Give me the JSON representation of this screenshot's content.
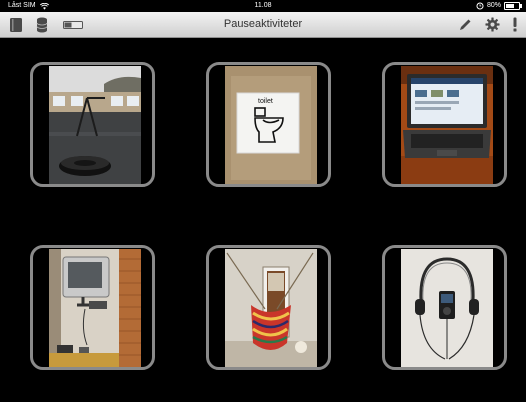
{
  "status_bar": {
    "carrier": "Låst SIM",
    "time": "11.08",
    "battery": "80%",
    "battery_level": 0.8,
    "icons": [
      "wifi-icon",
      "alarm-icon",
      "battery-icon"
    ]
  },
  "toolbar": {
    "title": "Pauseaktiviteter",
    "left_icons": [
      "book-icon",
      "database-icon",
      "toggle-icon"
    ],
    "right_icons": [
      "pencil-icon",
      "gear-icon",
      "exclamation-icon"
    ]
  },
  "tiles": [
    {
      "picture": "playground-tire-swing"
    },
    {
      "picture": "toilet-pictogram",
      "pictogram_label": "toilet"
    },
    {
      "picture": "laptop"
    },
    {
      "picture": "wall-mounted-tv"
    },
    {
      "picture": "hammock"
    },
    {
      "picture": "headphones-mp3-player"
    }
  ],
  "colors": {
    "background": "#000000",
    "tile_border": "#8a8a8a",
    "toolbar_top": "#f3f3f3",
    "toolbar_bottom": "#cfcfcf"
  }
}
